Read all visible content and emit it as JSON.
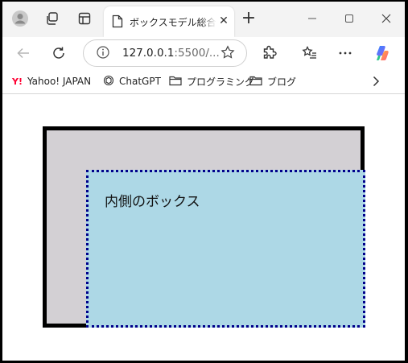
{
  "tab": {
    "title": "ボックスモデル総合問題"
  },
  "address": {
    "host": "127.0.0.1",
    "rest": ":5500/..."
  },
  "favorites": [
    {
      "label": "Yahoo! JAPAN",
      "icon": "yahoo-icon"
    },
    {
      "label": "ChatGPT",
      "icon": "chatgpt-icon"
    },
    {
      "label": "プログラミング",
      "icon": "folder-icon"
    },
    {
      "label": "ブログ",
      "icon": "folder-icon"
    }
  ],
  "content": {
    "inner_text": "内側のボックス"
  },
  "colors": {
    "outer_bg": "#d3d0d4",
    "outer_border": "#000000",
    "inner_bg": "#add8e6",
    "inner_border": "#00008b"
  }
}
